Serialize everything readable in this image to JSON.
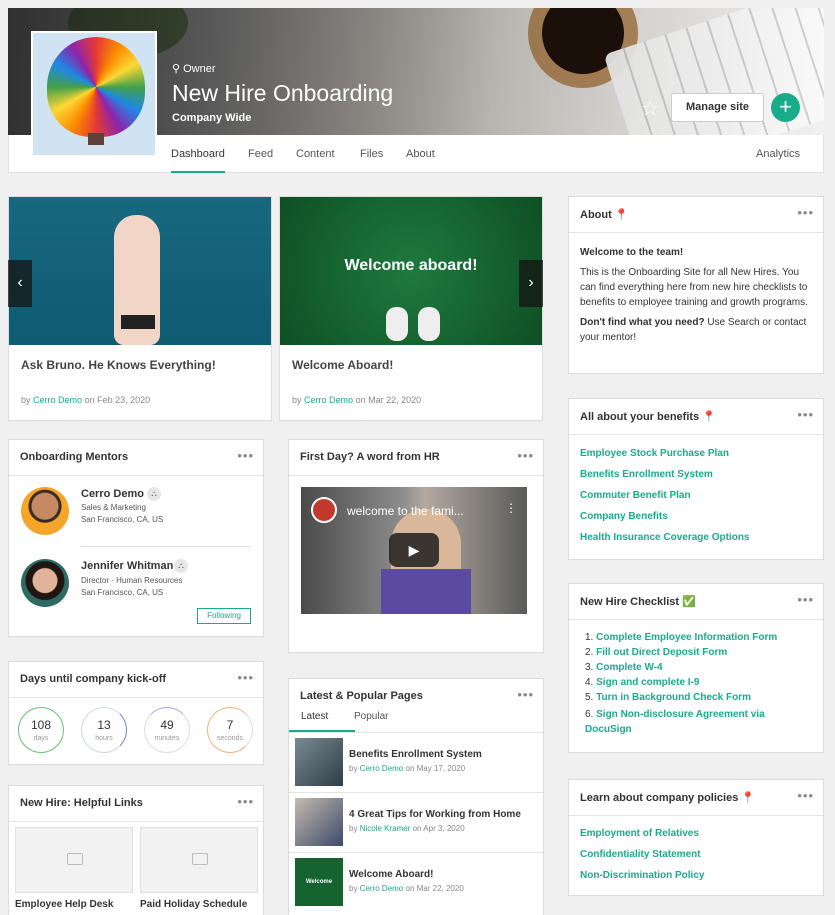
{
  "header": {
    "owner_label": "Owner",
    "site_title": "New Hire Onboarding",
    "site_subtitle": "Company Wide",
    "manage_label": "Manage site",
    "plus_label": "+"
  },
  "nav": {
    "tabs": [
      "Dashboard",
      "Feed",
      "Content",
      "Files",
      "About"
    ],
    "right_tab": "Analytics"
  },
  "carousel": {
    "slides": [
      {
        "title": "Ask Bruno. He Knows Everything!",
        "by": "by",
        "author": "Cerro Demo",
        "on": "on Feb 23, 2020"
      },
      {
        "title": "Welcome Aboard!",
        "by": "by",
        "author": "Cerro Demo",
        "on": "on Mar 22, 2020",
        "image_text": "Welcome aboard!"
      }
    ]
  },
  "mentors": {
    "title": "Onboarding Mentors",
    "items": [
      {
        "name": "Cerro Demo",
        "role": "Sales & Marketing",
        "location": "San Francisco, CA, US"
      },
      {
        "name": "Jennifer Whitman",
        "role": "Director - Human Resources",
        "location": "San Francisco, CA, US"
      }
    ],
    "following_label": "Following"
  },
  "countdown": {
    "title": "Days until company kick-off",
    "units": [
      {
        "value": "108",
        "label": "days"
      },
      {
        "value": "13",
        "label": "hours"
      },
      {
        "value": "49",
        "label": "minutes"
      },
      {
        "value": "7",
        "label": "seconds"
      }
    ]
  },
  "helpful": {
    "title": "New Hire: Helpful Links",
    "tiles": [
      "Employee Help Desk",
      "Paid Holiday Schedule"
    ]
  },
  "video": {
    "title": "First Day? A word from HR",
    "video_title": "welcome to the fami..."
  },
  "pages": {
    "title": "Latest & Popular Pages",
    "tabs": [
      "Latest",
      "Popular"
    ],
    "items": [
      {
        "title": "Benefits Enrollment System",
        "by": "by",
        "author": "Cerro Demo",
        "on": "on May 17, 2020"
      },
      {
        "title": "4 Great Tips for Working from Home",
        "by": "by",
        "author": "Nicole Kramer",
        "on": "on Apr 3, 2020"
      },
      {
        "title": "Welcome Aboard!",
        "by": "by",
        "author": "Cerro Demo",
        "on": "on Mar 22, 2020",
        "thumb_text": "Welcome aboard!"
      }
    ]
  },
  "about": {
    "title": "About 📍",
    "heading": "Welcome to the team!",
    "body": "This is the Onboarding Site for all New Hires. You can find everything here from new hire checklists to benefits to employee training and growth programs.",
    "q_bold": "Don't find what you need?",
    "q_rest": " Use Search or contact your mentor!"
  },
  "benefits": {
    "title": "All about your benefits 📍",
    "links": [
      "Employee Stock Purchase Plan",
      "Benefits Enrollment System",
      "Commuter Benefit Plan",
      "Company Benefits",
      "Health Insurance Coverage Options"
    ]
  },
  "checklist": {
    "title": "New Hire Checklist ✅",
    "items": [
      "Complete Employee Information Form",
      "Fill out Direct Deposit Form",
      "Complete W-4",
      "Sign and complete I-9",
      "Turn in Background Check Form",
      "Sign Non-disclosure Agreement via DocuSign"
    ]
  },
  "policies": {
    "title": "Learn about company policies 📍",
    "links": [
      "Employment of Relatives",
      "Confidentiality Statement",
      "Non-Discrimination Policy"
    ]
  },
  "colors": {
    "accent": "#1aab8a",
    "page_bg": "#f0f0f0",
    "card_border": "#dcdcdc"
  },
  "icons": [
    "owner-icon",
    "star-icon",
    "plus-icon",
    "more-dots-icon",
    "chevron-left-icon",
    "chevron-right-icon",
    "org-chart-icon",
    "play-icon",
    "image-placeholder-icon"
  ]
}
